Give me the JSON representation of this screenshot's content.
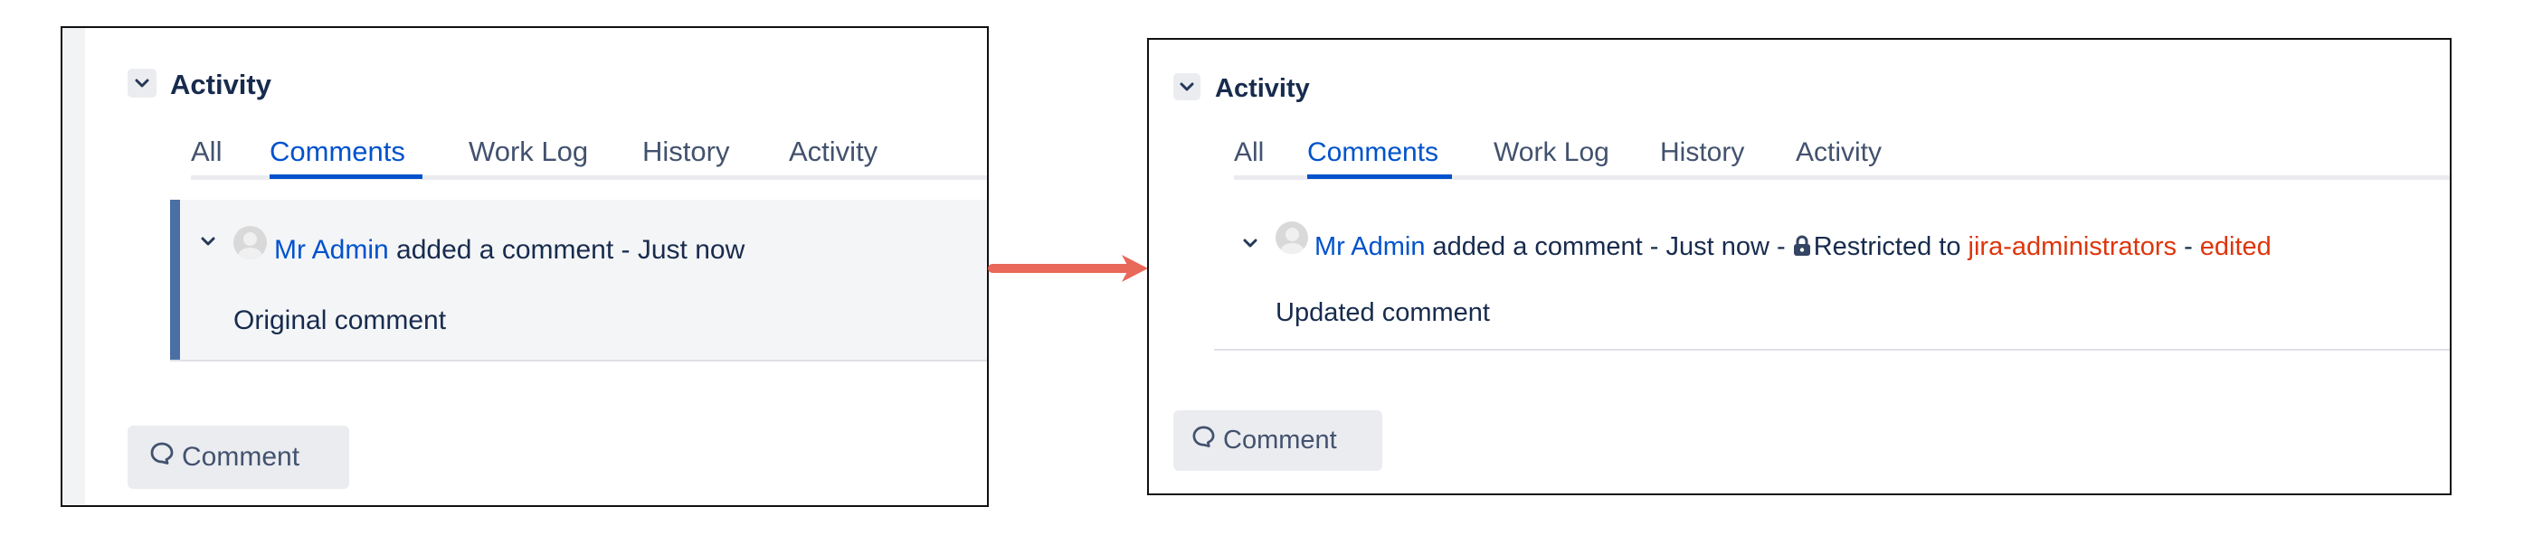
{
  "before": {
    "section_title": "Activity",
    "tabs": [
      {
        "label": "All",
        "active": false
      },
      {
        "label": "Comments",
        "active": true
      },
      {
        "label": "Work Log",
        "active": false
      },
      {
        "label": "History",
        "active": false
      },
      {
        "label": "Activity",
        "active": false
      }
    ],
    "comment": {
      "author": "Mr Admin",
      "action": "added a comment - Just now",
      "body": "Original comment"
    },
    "comment_button_label": "Comment"
  },
  "after": {
    "section_title": "Activity",
    "tabs": [
      {
        "label": "All",
        "active": false
      },
      {
        "label": "Comments",
        "active": true
      },
      {
        "label": "Work Log",
        "active": false
      },
      {
        "label": "History",
        "active": false
      },
      {
        "label": "Activity",
        "active": false
      }
    ],
    "comment": {
      "author": "Mr Admin",
      "action": "added a comment - Just now -",
      "restricted_prefix": "Restricted to",
      "restricted_group": "jira-administrators",
      "separator": "-",
      "edited_label": "edited",
      "body": "Updated comment"
    },
    "comment_button_label": "Comment"
  },
  "icons": {
    "collapse": "chevron-down-icon",
    "avatar": "default-avatar-icon",
    "lock": "lock-icon",
    "comment": "speech-bubble-icon",
    "transition_arrow": "right-arrow-icon"
  },
  "colors": {
    "link_blue": "#0052cc",
    "text_navy": "#172b4d",
    "restricted_red": "#de350b",
    "arrow_red": "#e8685a",
    "comment_bar": "#4a6fa5"
  }
}
